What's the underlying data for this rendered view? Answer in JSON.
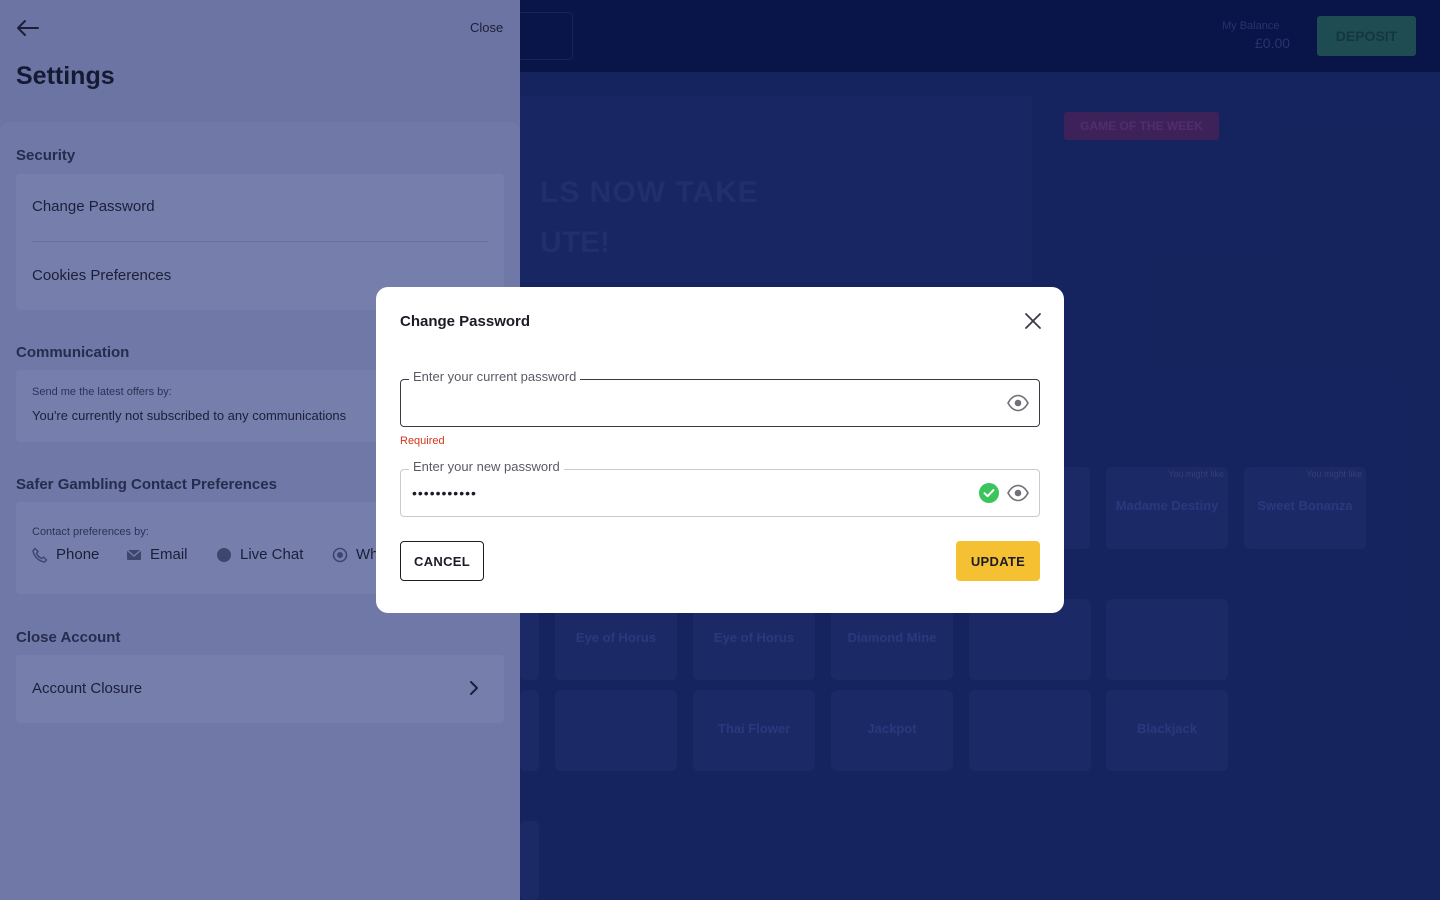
{
  "background": {
    "balance_label": "My Balance",
    "balance": "£0.00",
    "deposit_label": "DEPOSIT",
    "hero_line1": "LS NOW TAKE",
    "hero_line2": "UTE!",
    "game_of_week": "GAME OF THE WEEK",
    "tiles": [
      {
        "name": "Madame Destiny",
        "tag": "You might like"
      },
      {
        "name": "Sweet Bonanza",
        "tag": "You might like"
      },
      {
        "name": "Eye of Horus",
        "tag": ""
      },
      {
        "name": "Eye of Horus",
        "tag": ""
      },
      {
        "name": "Diamond Mine",
        "tag": ""
      },
      {
        "name": "",
        "tag": ""
      },
      {
        "name": "",
        "tag": ""
      },
      {
        "name": "",
        "tag": ""
      },
      {
        "name": "Thai Flower",
        "tag": ""
      },
      {
        "name": "Jackpot",
        "tag": ""
      },
      {
        "name": "",
        "tag": ""
      },
      {
        "name": "Blackjack",
        "tag": ""
      }
    ]
  },
  "drawer": {
    "close_label": "Close",
    "title": "Settings",
    "security": {
      "heading": "Security",
      "items": [
        "Change Password",
        "Cookies Preferences"
      ]
    },
    "communication": {
      "heading": "Communication",
      "label": "Send me the latest offers by:",
      "status": "You're currently not subscribed to any communications"
    },
    "safer_gambling": {
      "heading": "Safer Gambling Contact Preferences",
      "label": "Contact preferences by:",
      "options": [
        {
          "label": "Phone",
          "icon": "phone-icon"
        },
        {
          "label": "Email",
          "icon": "email-icon"
        },
        {
          "label": "Live Chat",
          "icon": "chat-icon"
        },
        {
          "label": "WhatsApp",
          "icon": "whatsapp-icon"
        }
      ]
    },
    "close_account": {
      "heading": "Close Account",
      "item": "Account Closure"
    }
  },
  "modal": {
    "title": "Change Password",
    "current_password": {
      "label": "Enter your current password",
      "value": "",
      "error": "Required"
    },
    "new_password": {
      "label": "Enter your new password",
      "value": "•••••••••••",
      "valid": true
    },
    "cancel_label": "CANCEL",
    "update_label": "UPDATE",
    "accent_color": "#f5c132",
    "error_color": "#d6341b",
    "valid_color": "#3bc45b"
  }
}
